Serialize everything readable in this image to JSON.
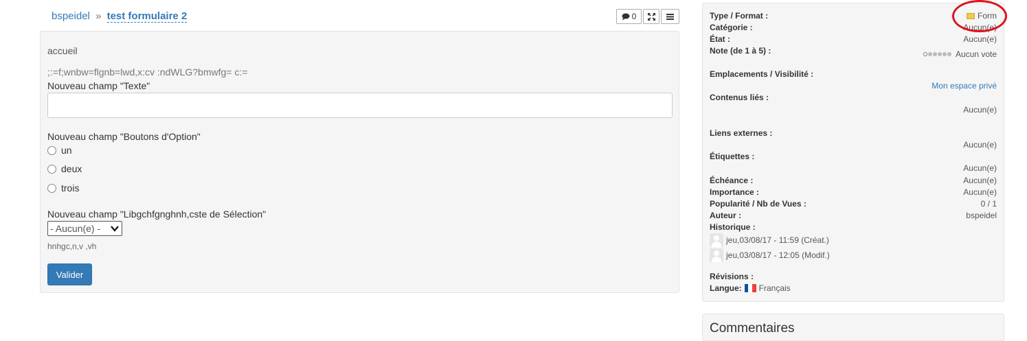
{
  "breadcrumb": {
    "user": "bspeidel",
    "separator": "»",
    "title": "test formulaire 2"
  },
  "toolbar": {
    "comment_count": "0"
  },
  "form": {
    "heading": "accueil",
    "garbled_text": ";:=f;wnbw=flgnb=lwd,x:cv :ndWLG?bmwfg= c:=",
    "text_field_label": "Nouveau champ \"Texte\"",
    "text_field_value": "",
    "radio_label": "Nouveau champ \"Boutons d'Option\"",
    "radio_options": [
      "un",
      "deux",
      "trois"
    ],
    "select_label": "Nouveau champ \"Libgchfgnghnh,cste de Sélection\"",
    "select_value": "- Aucun(e) -",
    "hint": "hnhgc,n,v ,vh",
    "submit_label": "Valider"
  },
  "info": {
    "type_label": "Type / Format :",
    "type_value": "Form",
    "category_label": "Catégorie :",
    "category_value": "Aucun(e)",
    "state_label": "État :",
    "state_value": "Aucun(e)",
    "rating_label": "Note (de 1 à 5) :",
    "rating_value": "Aucun vote",
    "locations_label": "Emplacements / Visibilité :",
    "locations_value": "Mon espace privé",
    "related_label": "Contenus liés :",
    "related_value": "Aucun(e)",
    "external_label": "Liens externes :",
    "external_value": "Aucun(e)",
    "tags_label": "Étiquettes :",
    "tags_value": "Aucun(e)",
    "deadline_label": "Échéance :",
    "deadline_value": "Aucun(e)",
    "importance_label": "Importance :",
    "importance_value": "Aucun(e)",
    "popularity_label": "Popularité / Nb de Vues :",
    "popularity_value": "0 / 1",
    "author_label": "Auteur :",
    "author_value": "bspeidel",
    "history_label": "Historique :",
    "history": [
      "jeu,03/08/17 - 11:59 (Créat.)",
      "jeu,03/08/17 - 12:05 (Modif.)"
    ],
    "revisions_label": "Révisions :",
    "language_label": "Langue:",
    "language_value": "Français"
  },
  "comments": {
    "title": "Commentaires"
  },
  "colors": {
    "link": "#337ab7",
    "primary_button": "#337ab7",
    "annotation": "#e0101a"
  },
  "icons": [
    "comment-icon",
    "fullscreen-icon",
    "menu-icon",
    "form-icon",
    "avatar-icon",
    "france-flag-icon"
  ]
}
